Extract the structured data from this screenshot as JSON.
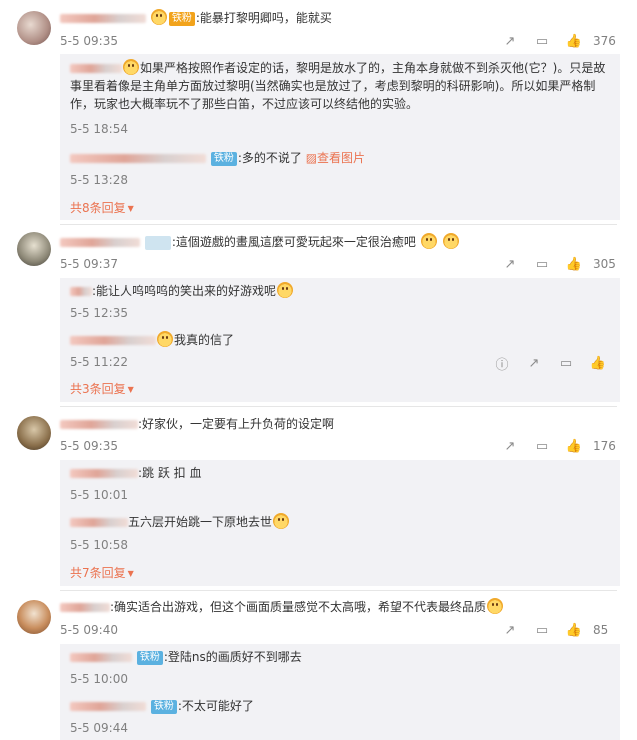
{
  "colors": {
    "link": "#eb7350",
    "badge": "#5bb1e0",
    "meta": "#808080",
    "reply_bg": "#f2f2f5"
  },
  "comments": [
    {
      "user": "",
      "badge": "铁粉",
      "text": ":能暴打黎明卿吗，能就买",
      "time": "5-5 09:35",
      "likes": "376",
      "replies": [
        {
          "user": "",
          "text": "如果严格按照作者设定的话，黎明是放水了的，主角本身就做不到杀灭他(它？)。只是故事里看着像是主角单方面放过黎明(当然确实也是放过了，考虑到黎明的科研影响)。所以如果严格制作，玩家也大概率玩不了那些白笛，不过应该可以终结他的实验。",
          "time": "5-5 18:54"
        },
        {
          "user": "",
          "badge": "铁粉",
          "text": ":多的不说了",
          "image_link": "查看图片",
          "time": "5-5 13:28"
        }
      ],
      "more": "共8条回复"
    },
    {
      "user": "",
      "badge": "",
      "text": ":這個遊戲的畫風這麼可愛玩起來一定很治癒吧",
      "time": "5-5 09:37",
      "likes": "305",
      "replies": [
        {
          "user": "",
          "text": ":能让人呜呜呜的笑出来的好游戏呢",
          "time": "5-5 12:35"
        },
        {
          "user": "",
          "text": "我真的信了",
          "time": "5-5 11:22"
        }
      ],
      "more": "共3条回复"
    },
    {
      "user": "",
      "badge": "",
      "text": ":好家伙，一定要有上升负荷的设定啊",
      "time": "5-5 09:35",
      "likes": "176",
      "replies": [
        {
          "user": "",
          "text": ":跳 跃 扣 血",
          "time": "5-5 10:01"
        },
        {
          "user": "",
          "text": "五六层开始跳一下原地去世",
          "time": "5-5 10:58"
        }
      ],
      "more": "共7条回复"
    },
    {
      "user": "",
      "badge": "",
      "text": ":确实适合出游戏，但这个画面质量感觉不太高哦，希望不代表最终品质",
      "time": "5-5 09:40",
      "likes": "85",
      "replies": [
        {
          "user": "",
          "badge": "铁粉",
          "text": ":登陆ns的画质好不到哪去",
          "time": "5-5 10:00"
        },
        {
          "user": "",
          "badge": "铁粉",
          "text": ":不太可能好了",
          "time": "5-5 09:44"
        }
      ],
      "more": ""
    }
  ]
}
